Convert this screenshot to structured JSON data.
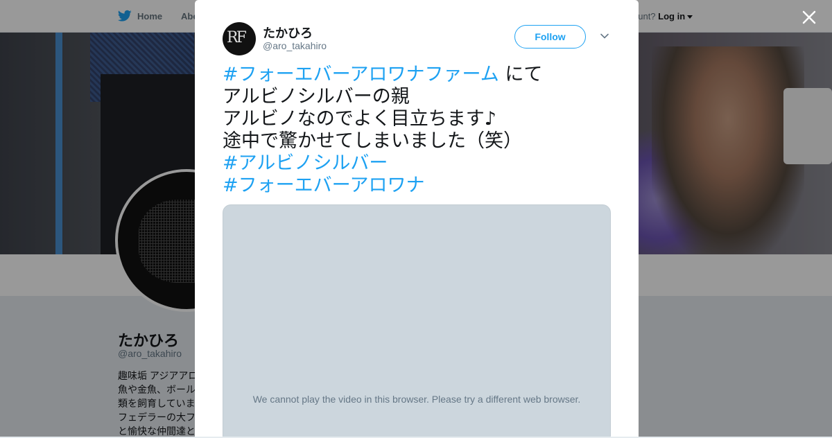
{
  "nav": {
    "home_label": "Home",
    "about_label": "Abo",
    "account_prompt": "ccount?",
    "login_label": "Log in"
  },
  "profile": {
    "name": "たかひろ",
    "handle": "@aro_takahiro",
    "bio": "趣味垢 アジアアロ\n魚や金魚、ボール\n類を飼育していま\nフェデラーの大フ\nと愉快な仲間達と"
  },
  "modal": {
    "user_name": "たかひろ",
    "user_handle": "@aro_takahiro",
    "avatar_text": "RF",
    "follow_label": "Follow",
    "tweet": {
      "line1_hashtag": "#フォーエバーアロワナファーム",
      "line1_text": " にて",
      "line2": "アルビノシルバーの親",
      "line3": "アルビノなのでよく目立ちます♪",
      "line4": "途中で驚かせてしまいました（笑）",
      "line5_hashtag": "#アルビノシルバー",
      "line6_hashtag": "#フォーエバーアロワナ"
    },
    "video_message": "We cannot play the video in this browser. Please try a different web browser."
  },
  "colors": {
    "twitter_blue": "#1da1f2",
    "text_dark": "#14171a",
    "text_muted": "#657786",
    "video_bg": "#ccd6dd"
  },
  "icons": [
    "twitter-bird-icon",
    "close-icon",
    "chevron-down-icon",
    "caret-down-icon"
  ]
}
